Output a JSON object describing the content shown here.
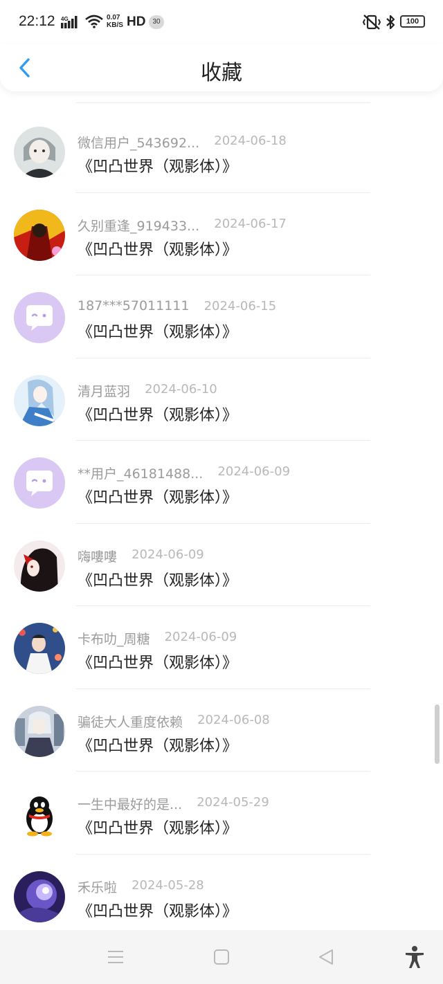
{
  "status_bar": {
    "time": "22:12",
    "network": "4G",
    "speed_value": "0.07",
    "speed_unit": "KB/S",
    "hd": "HD",
    "badge": "30",
    "battery": "100"
  },
  "header": {
    "title": "收藏",
    "back_icon": "chevron-left-icon",
    "accent_color": "#2f9bf0"
  },
  "favorites": [
    {
      "user": "微信用户_543692...",
      "date": "2024-06-18",
      "work": "《凹凸世界（观影体）》",
      "avatar": "anime-girl-grey"
    },
    {
      "user": "久别重逢_919433...",
      "date": "2024-06-17",
      "work": "《凹凸世界（观影体）》",
      "avatar": "anime-red-gold"
    },
    {
      "user": "187***57011111",
      "date": "2024-06-15",
      "work": "《凹凸世界（观影体）》",
      "avatar": "default-chat-bubble"
    },
    {
      "user": "清月蓝羽",
      "date": "2024-06-10",
      "work": "《凹凸世界（观影体）》",
      "avatar": "anime-blue-hair"
    },
    {
      "user": "**用户_46181488...",
      "date": "2024-06-09",
      "work": "《凹凸世界（观影体）》",
      "avatar": "default-chat-bubble"
    },
    {
      "user": "嗨嘍嘍",
      "date": "2024-06-09",
      "work": "《凹凸世界（观影体）》",
      "avatar": "anime-dark-red"
    },
    {
      "user": "卡布叻_周糖",
      "date": "2024-06-09",
      "work": "《凹凸世界（观影体）》",
      "avatar": "photo-stage"
    },
    {
      "user": "骗徒大人重度依赖",
      "date": "2024-06-08",
      "work": "《凹凸世界（观影体）》",
      "avatar": "anime-city"
    },
    {
      "user": "一生中最好的是...",
      "date": "2024-05-29",
      "work": "《凹凸世界（观影体）》",
      "avatar": "qq-penguin"
    },
    {
      "user": "禾乐啦",
      "date": "2024-05-28",
      "work": "《凹凸世界（观影体）》",
      "avatar": "anime-purple"
    }
  ],
  "nav_bar": {
    "icons": [
      "menu-icon",
      "home-square-icon",
      "back-triangle-icon",
      "accessibility-icon"
    ]
  }
}
